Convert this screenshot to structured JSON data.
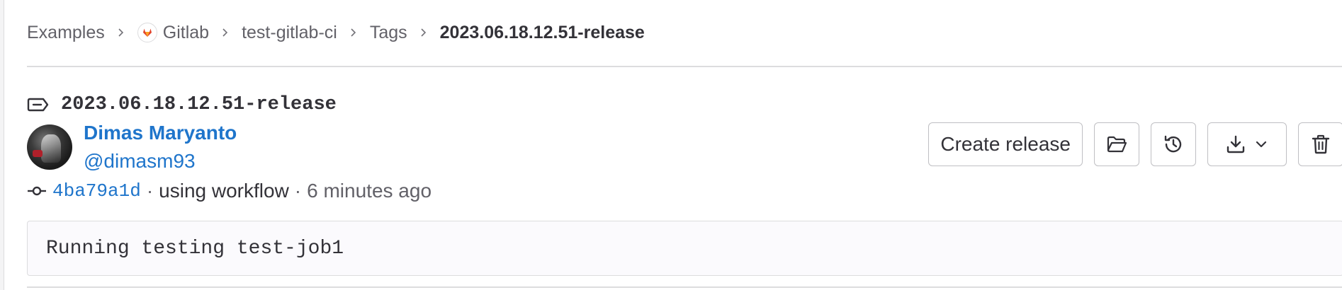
{
  "breadcrumb": {
    "items": [
      "Examples",
      "Gitlab",
      "test-gitlab-ci",
      "Tags"
    ],
    "current": "2023.06.18.12.51-release"
  },
  "tag": {
    "name": "2023.06.18.12.51-release"
  },
  "author": {
    "name": "Dimas Maryanto",
    "handle": "@dimasm93"
  },
  "commit": {
    "sha": "4ba79a1d",
    "message": "using workflow",
    "separator": "·",
    "time": "6 minutes ago"
  },
  "actions": {
    "create_release": "Create release",
    "icons": [
      "folder-icon",
      "history-icon",
      "download-icon",
      "chevron-down-icon",
      "trash-icon"
    ]
  },
  "tag_message": "Running testing test-job1",
  "colors": {
    "link": "#1f75cb",
    "text": "#333238",
    "muted": "#626168",
    "border": "#dcdcde"
  }
}
